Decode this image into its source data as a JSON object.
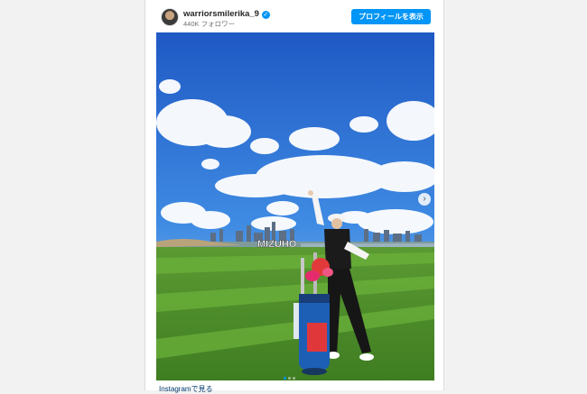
{
  "post": {
    "username": "warriorsmilerika_9",
    "followers": "440K フォロワー",
    "profile_button": "プロフィールを表示",
    "photo_sign": "MIZUHO",
    "carousel": {
      "total": 3,
      "active": 1
    },
    "caption_link": "Instagramで見る"
  },
  "colors": {
    "accent": "#0095f6"
  }
}
